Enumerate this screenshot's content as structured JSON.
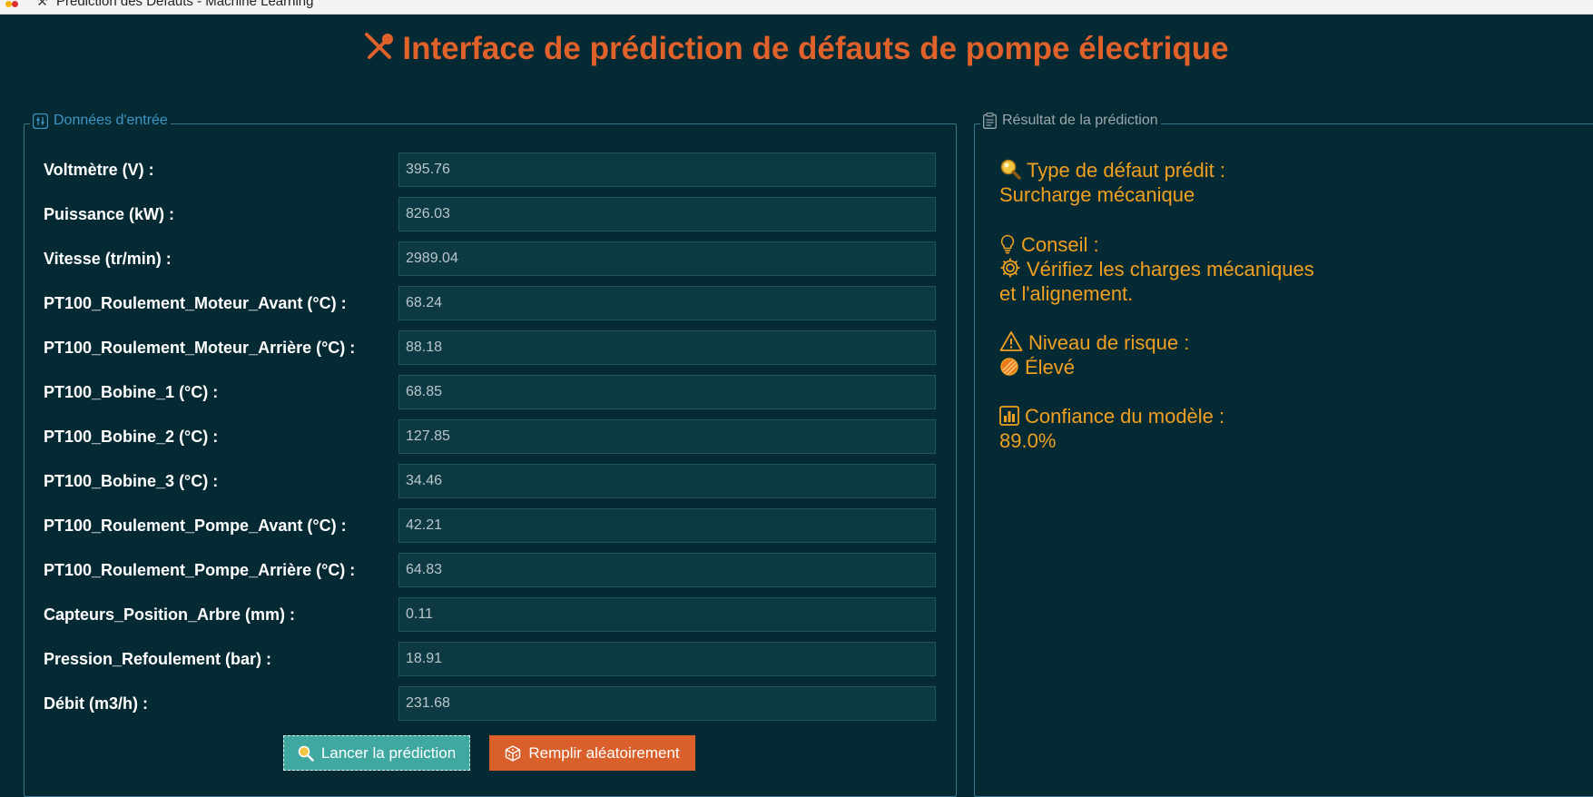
{
  "window": {
    "title": "Prédiction des Défauts - Machine Learning",
    "app_icon": "tools-icon"
  },
  "header": {
    "title": "Interface de prédiction de défauts de pompe électrique",
    "icon": "tools-icon",
    "color": "#e0612a"
  },
  "input_panel": {
    "legend": "Données d'entrée",
    "legend_icon": "sliders-icon",
    "fields": [
      {
        "label": "Voltmètre (V) :",
        "value": "395.76"
      },
      {
        "label": "Puissance (kW) :",
        "value": "826.03"
      },
      {
        "label": "Vitesse (tr/min) :",
        "value": "2989.04"
      },
      {
        "label": "PT100_Roulement_Moteur_Avant (°C) :",
        "value": "68.24"
      },
      {
        "label": "PT100_Roulement_Moteur_Arrière (°C) :",
        "value": "88.18"
      },
      {
        "label": "PT100_Bobine_1 (°C) :",
        "value": "68.85"
      },
      {
        "label": "PT100_Bobine_2 (°C) :",
        "value": "127.85"
      },
      {
        "label": "PT100_Bobine_3 (°C) :",
        "value": "34.46"
      },
      {
        "label": "PT100_Roulement_Pompe_Avant (°C) :",
        "value": "42.21"
      },
      {
        "label": "PT100_Roulement_Pompe_Arrière (°C) :",
        "value": "64.83"
      },
      {
        "label": "Capteurs_Position_Arbre (mm) :",
        "value": "0.11"
      },
      {
        "label": "Pression_Refoulement (bar) :",
        "value": "18.91"
      },
      {
        "label": "Débit (m3/h) :",
        "value": "231.68"
      }
    ],
    "buttons": {
      "predict": {
        "label": "Lancer la prédiction",
        "icon": "magnifier-icon",
        "color": "#3fa8a0"
      },
      "random": {
        "label": "Remplir aléatoirement",
        "icon": "dice-icon",
        "color": "#d9602b"
      }
    }
  },
  "result_panel": {
    "legend": "Résultat de la prédiction",
    "legend_icon": "clipboard-icon",
    "color": "#f0a020",
    "defect_type_label": "Type de défaut prédit :",
    "defect_type_value": "Surcharge mécanique",
    "advice_label": "Conseil :",
    "advice_line1": "Vérifiez les charges mécaniques",
    "advice_line2": "et l'alignement.",
    "risk_label": "Niveau de risque :",
    "risk_value": "Élevé",
    "confidence_label": "Confiance du modèle :",
    "confidence_value": "89.0%"
  }
}
